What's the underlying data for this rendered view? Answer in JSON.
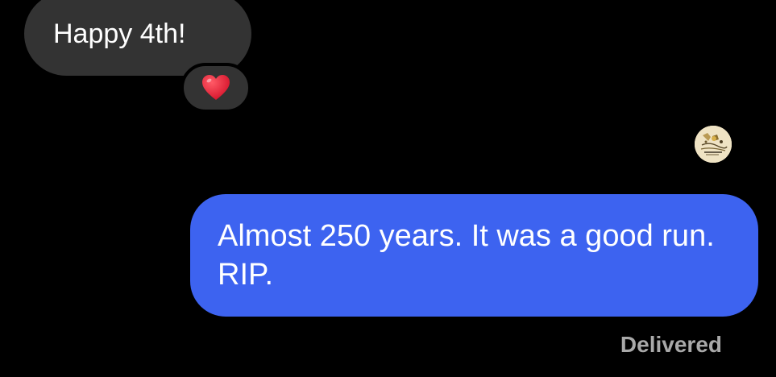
{
  "messages": {
    "received": {
      "text": "Happy 4th!",
      "reaction": {
        "icon": "heart-icon",
        "color": "#e8283a"
      }
    },
    "sent": {
      "text": "Almost 250 years. It was a good run. RIP.",
      "status": "Delivered"
    }
  },
  "colors": {
    "background": "#000000",
    "received_bubble": "#333333",
    "sent_bubble": "#3d63f0",
    "status_text": "#a9a9a9"
  }
}
